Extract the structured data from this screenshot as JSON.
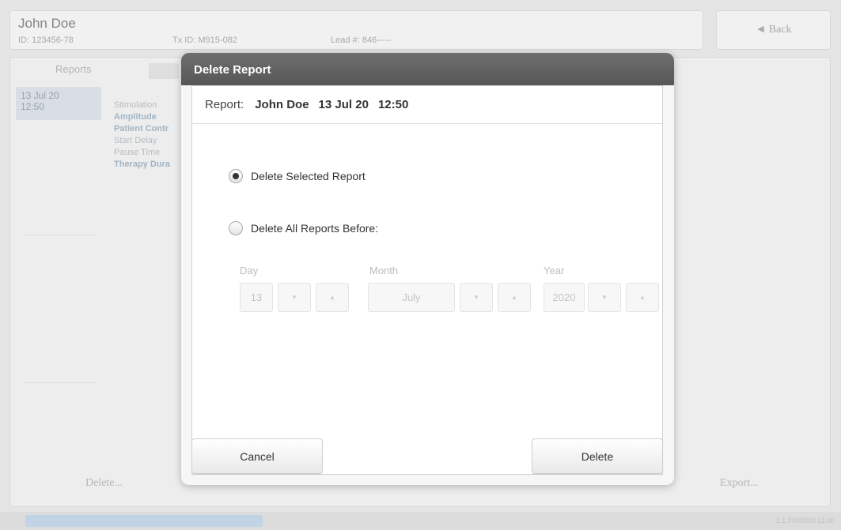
{
  "background": {
    "patient": {
      "name": "John Doe",
      "id_text": "ID: 123456-78",
      "device_text": "Tx ID: M915-082",
      "extra_text": "Lead #: 846-----"
    },
    "back_label": "◄ Back",
    "tabs": [
      "Reports"
    ],
    "report_list": [
      {
        "date": "13 Jul 20",
        "time": "12:50"
      }
    ],
    "details": [
      "Stimulation",
      "Amplitude",
      "Patient Contr",
      "Start Delay",
      "Pause Time",
      "Therapy Dura"
    ],
    "delete_label": "Delete...",
    "export_label": "Export...",
    "status_right": "1.1.0000000 11:00"
  },
  "dialog": {
    "title": "Delete Report",
    "report_label": "Report:",
    "report_name": "John Doe",
    "report_date": "13 Jul 20",
    "report_time": "12:50",
    "options": [
      {
        "label": "Delete Selected Report",
        "selected": true
      },
      {
        "label": "Delete All Reports Before:",
        "selected": false
      }
    ],
    "date_fields": {
      "day": {
        "label": "Day",
        "value": "13"
      },
      "month": {
        "label": "Month",
        "value": "July"
      },
      "year": {
        "label": "Year",
        "value": "2020"
      }
    },
    "down_glyph": "▼",
    "up_glyph": "▲",
    "cancel_label": "Cancel",
    "delete_label": "Delete"
  },
  "colors": {
    "dialog_header": "#5f5f5f",
    "selection_highlight": "#c9d2d9"
  }
}
